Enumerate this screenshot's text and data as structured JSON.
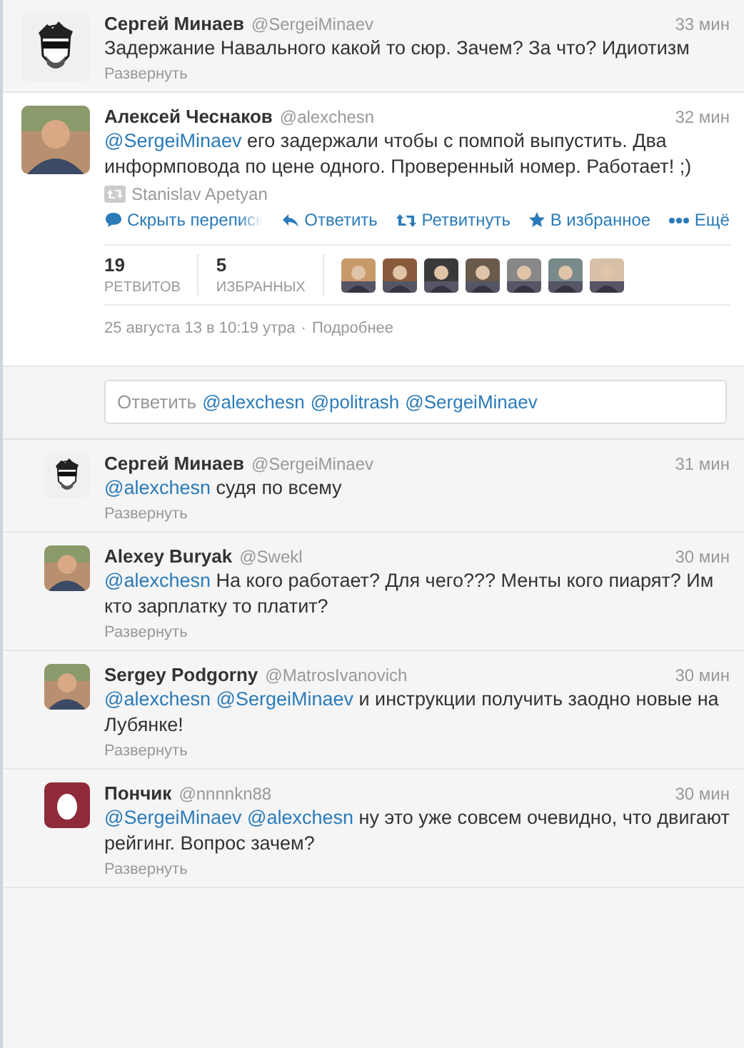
{
  "parent_tweet": {
    "name": "Сергей Минаев",
    "handle": "@SergeiMinaev",
    "time": "33 мин",
    "avatar": {
      "kind": "sketch"
    },
    "text": [
      {
        "kind": "text",
        "text": "Задержание Навального какой то сюр. Зачем? За что? Идиотизм"
      }
    ],
    "expand": "Развернуть"
  },
  "main_tweet": {
    "name": "Алексей Чеснаков",
    "handle": "@alexchesn",
    "time": "32 мин",
    "avatar": {
      "kind": "picture"
    },
    "text": [
      {
        "kind": "mention",
        "text": "@SergeiMinaev"
      },
      {
        "kind": "text",
        "text": " его задержали чтобы с помпой выпустить. Два информповода по цене одного. Проверенный номер. Работает! ;)"
      }
    ],
    "retweeted_by": "Stanislav Apetyan",
    "actions": [
      {
        "kind": "conversation",
        "label": "Скрыть переписк"
      },
      {
        "kind": "reply",
        "label": "Ответить"
      },
      {
        "kind": "retweet",
        "label": "Ретвитнуть"
      },
      {
        "kind": "favorite",
        "label": "В избранное"
      },
      {
        "kind": "more",
        "label": "Ещё"
      }
    ],
    "stats": [
      {
        "count": "19",
        "label": "РЕТВИТОВ"
      },
      {
        "count": "5",
        "label": "ИЗБРАННЫХ"
      }
    ],
    "favoriters": [
      {
        "kind": "picture"
      },
      {
        "kind": "picture"
      },
      {
        "kind": "picture"
      },
      {
        "kind": "picture"
      },
      {
        "kind": "picture"
      },
      {
        "kind": "picture"
      },
      {
        "kind": "picture"
      }
    ],
    "date": "25 августа 13 в 10:19 утра",
    "separator": "·",
    "details": "Подробнее"
  },
  "reply_box": {
    "placeholder": "Ответить",
    "mentions": [
      "@alexchesn",
      "@politrash",
      "@SergeiMinaev"
    ]
  },
  "replies": [
    {
      "name": "Сергей Минаев",
      "handle": "@SergeiMinaev",
      "time": "31 мин",
      "avatar": {
        "kind": "sketch"
      },
      "text": [
        {
          "kind": "mention",
          "text": "@alexchesn"
        },
        {
          "kind": "text",
          "text": " судя по всему"
        }
      ],
      "expand": "Развернуть"
    },
    {
      "name": "Alexey Buryak",
      "handle": "@Swekl",
      "time": "30 мин",
      "avatar": {
        "kind": "picture"
      },
      "text": [
        {
          "kind": "mention",
          "text": "@alexchesn"
        },
        {
          "kind": "text",
          "text": " На кого работает? Для чего??? Менты кого пиарят? Им кто зарплатку то платит?"
        }
      ],
      "expand": "Развернуть"
    },
    {
      "name": "Sergey Podgorny",
      "handle": "@MatrosIvanovich",
      "time": "30 мин",
      "avatar": {
        "kind": "picture"
      },
      "text": [
        {
          "kind": "mention",
          "text": "@alexchesn"
        },
        {
          "kind": "mention",
          "text": "@SergeiMinaev"
        },
        {
          "kind": "text",
          "text": " и  инструкции получить заодно новые на Лубянке!"
        }
      ],
      "expand": "Развернуть"
    },
    {
      "name": "Пончик",
      "handle": "@nnnnkn88",
      "time": "30 мин",
      "avatar": {
        "kind": "egg"
      },
      "text": [
        {
          "kind": "mention",
          "text": "@SergeiMinaev"
        },
        {
          "kind": "mention",
          "text": "@alexchesn"
        },
        {
          "kind": "text",
          "text": " ну это уже совсем очевидно, что двигают рейгинг. Вопрос зачем?"
        }
      ],
      "expand": "Развернуть"
    }
  ]
}
